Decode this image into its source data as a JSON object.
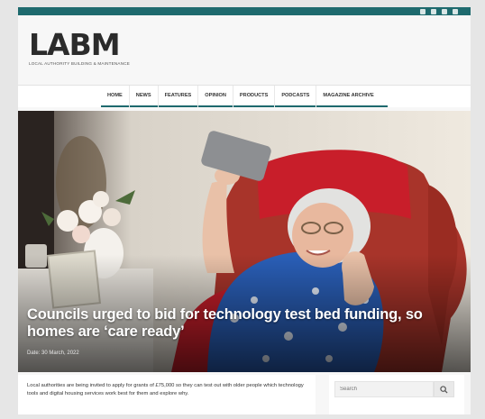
{
  "site": {
    "logo": "LABM",
    "logo_tagline": "LOCAL AUTHORITY BUILDING & MAINTENANCE"
  },
  "nav": {
    "items": [
      "HOME",
      "NEWS",
      "FEATURES",
      "OPINION",
      "PRODUCTS",
      "PODCASTS",
      "MAGAZINE ARCHIVE"
    ],
    "active": "HOME"
  },
  "article": {
    "title": "Councils urged to bid for technology test bed funding, so homes are ‘care ready’",
    "date": "Date: 30 March, 2022",
    "excerpt": "Local authorities are being invited to apply for grants of £75,000 so they can test out with older people which technology tools and digital housing services work best for them and explore why."
  },
  "search": {
    "placeholder": "Search"
  },
  "colors": {
    "brand_teal": "#1e6a6e",
    "chair_red": "#c81e2a"
  },
  "icons": [
    "facebook-icon",
    "twitter-icon",
    "linkedin-icon",
    "search-icon"
  ]
}
